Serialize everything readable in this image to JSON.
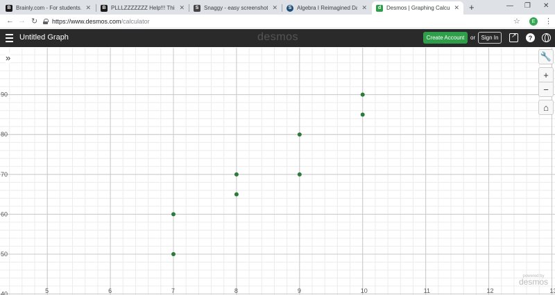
{
  "browser": {
    "tabs": [
      {
        "title": "Brainly.com - For students. By",
        "favicon": "brainly-icon",
        "color": "#1a1a1a",
        "glyph": "B",
        "active": false
      },
      {
        "title": "PLLLZZZZZZZ Help!!! This tabl",
        "favicon": "brainly-icon",
        "color": "#1a1a1a",
        "glyph": "B",
        "active": false
      },
      {
        "title": "Snaggy - easy screenshots",
        "favicon": "snaggy-icon",
        "color": "#444444",
        "glyph": "S",
        "active": false
      },
      {
        "title": "Algebra I Reimagined Day Ass",
        "favicon": "schoology-icon",
        "color": "#1f4e79",
        "glyph": "S",
        "active": false
      },
      {
        "title": "Desmos | Graphing Calculator",
        "favicon": "desmos-icon",
        "color": "#2f9e4a",
        "glyph": "d",
        "active": true
      }
    ],
    "url_host": "https://www.desmos.com",
    "url_path": "/calculator",
    "profile_initial": "E"
  },
  "desmos": {
    "graph_title": "Untitled Graph",
    "logo": "desmos",
    "create_account": "Create Account",
    "or": "or",
    "sign_in": "Sign In",
    "help": "?",
    "powered_by": "powered by",
    "powered_brand": "desmos"
  },
  "chart_data": {
    "type": "scatter",
    "x": [
      7,
      7,
      8,
      8,
      9,
      9,
      10,
      10
    ],
    "y": [
      50,
      60,
      65,
      70,
      70,
      80,
      85,
      90
    ],
    "point_color": "#2d7a3a",
    "xlim": [
      4.25,
      13.05
    ],
    "ylim": [
      39.75,
      101.75
    ],
    "x_ticks": [
      5,
      6,
      7,
      8,
      9,
      10,
      11,
      12,
      13
    ],
    "y_ticks": [
      40,
      50,
      60,
      70,
      80,
      90
    ],
    "grid": true
  }
}
